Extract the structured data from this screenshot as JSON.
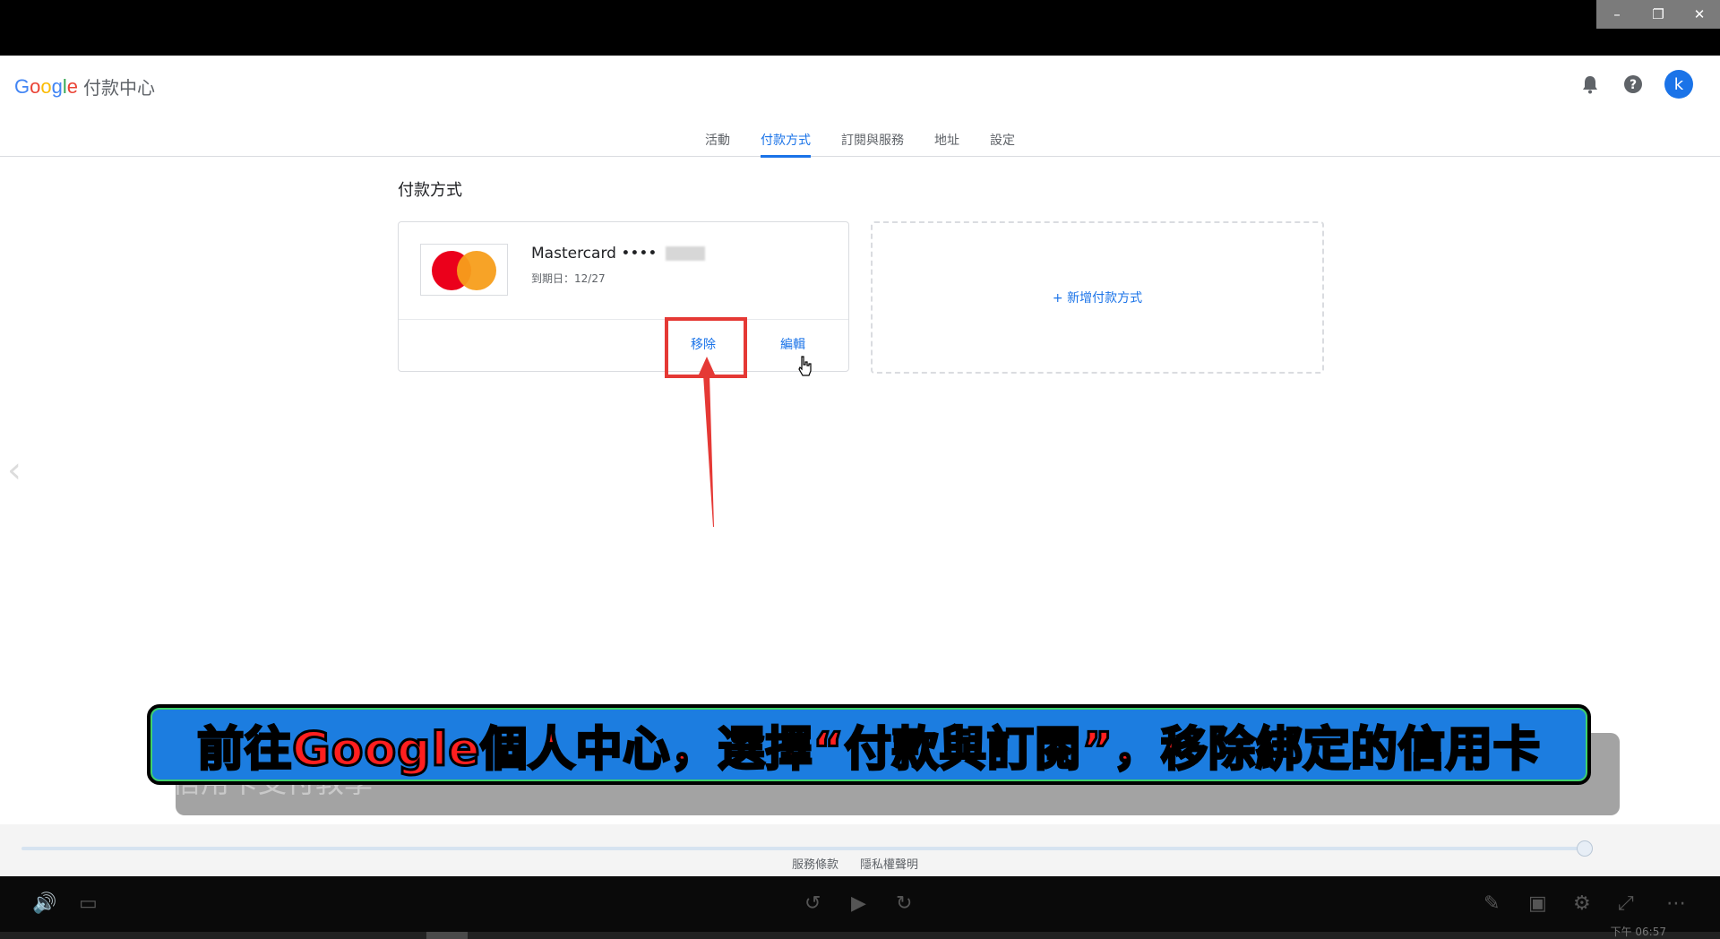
{
  "window": {
    "min": "–",
    "restore": "❐",
    "close": "✕"
  },
  "header": {
    "logo_letters": [
      "G",
      "o",
      "o",
      "g",
      "l",
      "e"
    ],
    "logo_colors": [
      "#4285f4",
      "#ea4335",
      "#fbbc05",
      "#4285f4",
      "#34a853",
      "#ea4335"
    ],
    "product": "付款中心",
    "avatar_letter": "k",
    "icons": [
      "bell-icon",
      "help-icon"
    ]
  },
  "tabs": [
    {
      "label": "活動",
      "active": false
    },
    {
      "label": "付款方式",
      "active": true
    },
    {
      "label": "訂閱與服務",
      "active": false
    },
    {
      "label": "地址",
      "active": false
    },
    {
      "label": "設定",
      "active": false
    }
  ],
  "page_title": "付款方式",
  "card": {
    "brand": "Mastercard ••••",
    "expiry": "到期日：12/27",
    "remove_label": "移除",
    "edit_label": "編輯"
  },
  "add_payment": "+ 新增付款方式",
  "overlay": {
    "banner_text": "前往Google個人中心，選擇“付款與訂閱”，移除綁定的信用卡",
    "ghost_text": "信用卡支付教學"
  },
  "footer": {
    "links": [
      "服務條款",
      "隱私權聲明"
    ]
  },
  "player": {
    "clock": "下午 06:57",
    "progress_fraction": 0.26
  },
  "colors": {
    "accent": "#1a73e8",
    "highlight": "#e53935"
  }
}
